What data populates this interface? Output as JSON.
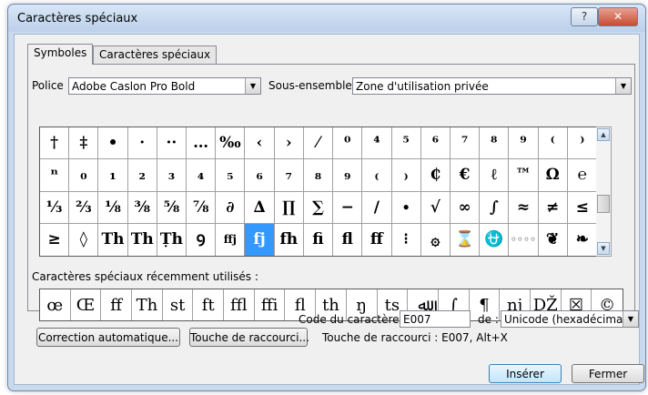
{
  "window": {
    "title": "Caractères spéciaux",
    "help_glyph": "?",
    "close_glyph": "✕"
  },
  "tabs": [
    {
      "label": "Symboles",
      "active": true
    },
    {
      "label": "Caractères spéciaux",
      "active": false
    }
  ],
  "font": {
    "label": "Police :",
    "value": "Adobe Caslon Pro Bold"
  },
  "subset": {
    "label": "Sous-ensemble :",
    "value": "Zone d'utilisation privée"
  },
  "grid": {
    "selected_index": 64,
    "rows": [
      [
        "†",
        "‡",
        "•",
        "·",
        "··",
        "…",
        "‰",
        "‹",
        "›",
        "⁄",
        "⁰",
        "⁴",
        "⁵",
        "⁶",
        "⁷",
        "⁸",
        "⁹",
        "⁽",
        "⁾"
      ],
      [
        "ⁿ",
        "₀",
        "₁",
        "₂",
        "₃",
        "₄",
        "₅",
        "₆",
        "₇",
        "₈",
        "₉",
        "₍",
        "₎",
        "₵",
        "€",
        "ℓ",
        "™",
        "Ω",
        "℮"
      ],
      [
        "⅓",
        "⅔",
        "⅛",
        "⅜",
        "⅝",
        "⅞",
        "∂",
        "∆",
        "∏",
        "∑",
        "−",
        "∕",
        "∙",
        "√",
        "∞",
        "∫",
        "≈",
        "≠",
        "≤"
      ],
      [
        "≥",
        "◊",
        "Th",
        "Th",
        "Ṭh",
        "Ꝯ",
        "ffj",
        "fj",
        "fh",
        "fi",
        "fl",
        "ff",
        "⁝",
        "۞",
        "⌛",
        "⛎",
        "◦◦◦◦",
        "❦",
        "❧"
      ]
    ]
  },
  "recent": {
    "label": "Caractères spéciaux récemment utilisés :",
    "items": [
      "œ",
      "Œ",
      "ff",
      "Th",
      "st",
      "ft",
      "ffl",
      "ffi",
      "fl",
      "th",
      "ŋ",
      "ts",
      "ﷲ",
      "∫",
      "¶",
      "nj",
      "Ǆ",
      "☒",
      "©"
    ]
  },
  "char_code": {
    "label": "Code du caractère :",
    "value": "E007",
    "from_label": "de :",
    "from_value": "Unicode (hexadécimal)"
  },
  "buttons": {
    "autocorrect": "Correction automatique...",
    "shortcut_key": "Touche de raccourci...",
    "insert": "Insérer",
    "cancel": "Fermer"
  },
  "shortcut_info": "Touche de raccourci : E007, Alt+X",
  "colors": {
    "selection": "#3399ff",
    "title_bar": "#c9d9ee",
    "close_button": "#c74b33"
  }
}
